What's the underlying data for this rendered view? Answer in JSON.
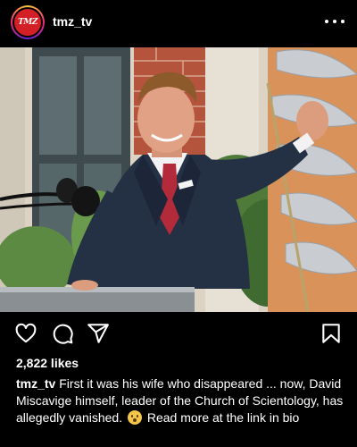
{
  "post": {
    "username": "tmz_tv",
    "avatar_text": "TMZ",
    "likes": "2,822 likes",
    "caption_user": "tmz_tv",
    "caption_text_1": " First it was his wife who disappeared ... now, David Miscavige himself, leader of the Church of Scientology, has allegedly vanished. ",
    "caption_text_2": " Read more at the link in bio"
  },
  "icons": {
    "more": "more-options-icon",
    "like": "heart-icon",
    "comment": "comment-icon",
    "share": "share-icon",
    "save": "bookmark-icon",
    "emoji": "hushed-face-emoji"
  },
  "colors": {
    "background": "#000000",
    "text": "#ffffff",
    "avatar_brand": "#d31f26"
  }
}
